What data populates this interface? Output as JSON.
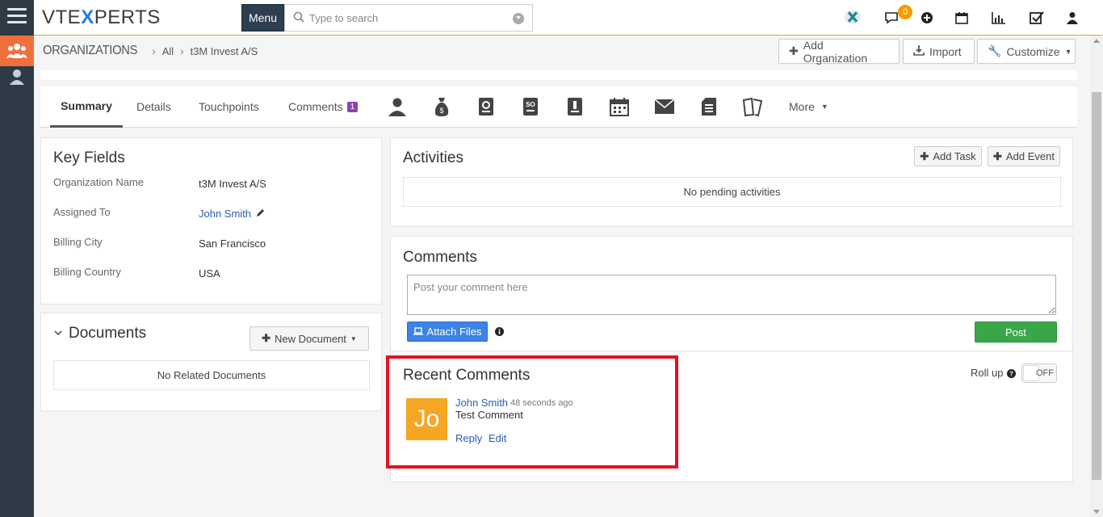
{
  "app": {
    "logo_prefix": "VTE",
    "logo_x": "X",
    "logo_suffix": "PERTS",
    "menu_label": "Menu",
    "search_placeholder": "Type to search",
    "notification_count": "0"
  },
  "breadcrumb": {
    "module": "Organizations",
    "filter": "All",
    "record": "t3M Invest A/S"
  },
  "header_buttons": {
    "add_org": "Add Organization",
    "import": "Import",
    "customize": "Customize"
  },
  "tabs": {
    "summary": "Summary",
    "details": "Details",
    "touchpoints": "Touchpoints",
    "comments": "Comments",
    "comments_count": "1",
    "more": "More"
  },
  "key_fields": {
    "title": "Key Fields",
    "rows": [
      {
        "label": "Organization Name",
        "value": "t3M Invest A/S"
      },
      {
        "label": "Assigned To",
        "value": "John Smith"
      },
      {
        "label": "Billing City",
        "value": "San Francisco"
      },
      {
        "label": "Billing Country",
        "value": "USA"
      }
    ]
  },
  "documents": {
    "title": "Documents",
    "new_button": "New Document",
    "empty_text": "No Related Documents"
  },
  "activities": {
    "title": "Activities",
    "add_task": "Add Task",
    "add_event": "Add Event",
    "empty_text": "No pending activities"
  },
  "comments": {
    "title": "Comments",
    "placeholder": "Post your comment here",
    "attach_files": "Attach Files",
    "post": "Post",
    "recent_title": "Recent Comments",
    "rollup_label": "Roll up",
    "rollup_state": "OFF",
    "items": [
      {
        "avatar_initials": "Jo",
        "author": "John Smith",
        "time": "48 seconds ago",
        "text": "Test Comment",
        "reply": "Reply",
        "edit": "Edit"
      }
    ]
  },
  "colors": {
    "sidebar_bg": "#2f3a47",
    "active_module": "#f0703d",
    "accent_blue": "#2a5db0",
    "attach_blue": "#3b84e6",
    "post_green": "#3aa64a",
    "highlight_red": "#e3121f",
    "avatar_orange": "#f5a622"
  }
}
